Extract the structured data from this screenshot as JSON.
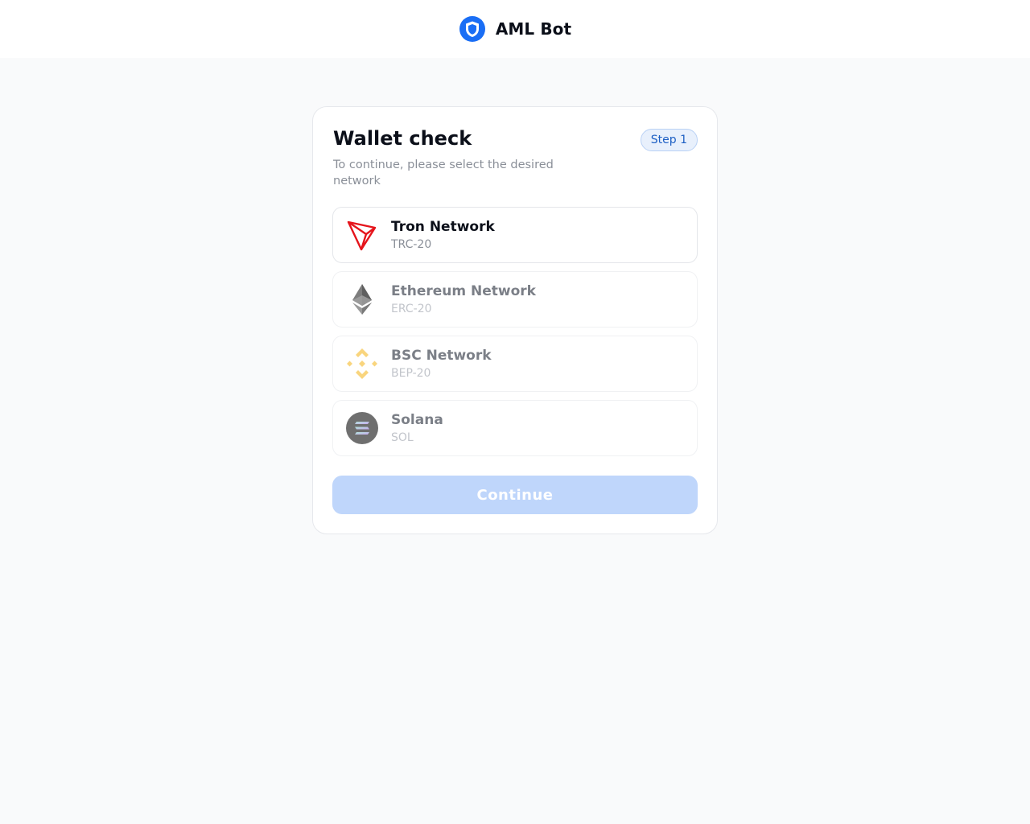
{
  "header": {
    "brand_name": "AML Bot",
    "logo_icon": "shield-icon",
    "accent_color": "#1a6ef5"
  },
  "card": {
    "title": "Wallet check",
    "step_badge": "Step 1",
    "subtitle": "To continue, please select the desired network"
  },
  "networks": [
    {
      "name": "Tron Network",
      "code": "TRC-20",
      "icon": "tron-icon",
      "state": "selected"
    },
    {
      "name": "Ethereum Network",
      "code": "ERC-20",
      "icon": "ethereum-icon",
      "state": "dimmed"
    },
    {
      "name": "BSC Network",
      "code": "BEP-20",
      "icon": "binance-icon",
      "state": "dimmed"
    },
    {
      "name": "Solana",
      "code": "SOL",
      "icon": "solana-icon",
      "state": "dimmed"
    }
  ],
  "continue_button": {
    "label": "Continue",
    "enabled": false
  }
}
